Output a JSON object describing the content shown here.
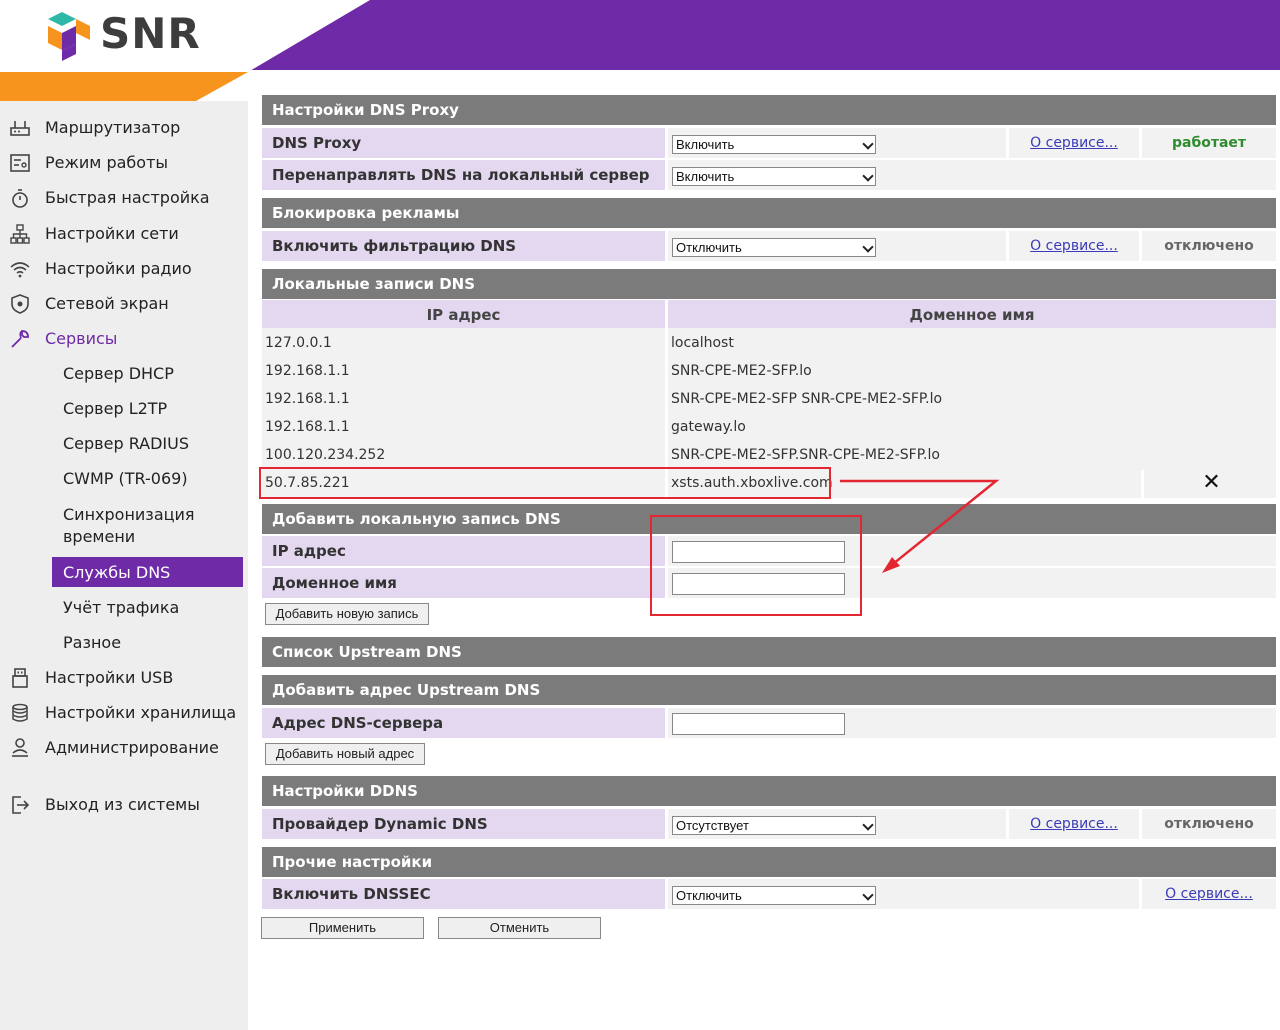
{
  "brand": {
    "name": "SNR",
    "colors": {
      "purple": "#6f2aa8",
      "orange": "#f7941d",
      "dark": "#3d3d3d",
      "highlight": "#e3262f"
    }
  },
  "sidebar": {
    "items": [
      {
        "label": "Маршрутизатор",
        "icon": "router-icon"
      },
      {
        "label": "Режим работы",
        "icon": "mode-icon"
      },
      {
        "label": "Быстрая настройка",
        "icon": "stopwatch-icon"
      },
      {
        "label": "Настройки сети",
        "icon": "network-icon"
      },
      {
        "label": "Настройки радио",
        "icon": "wifi-icon"
      },
      {
        "label": "Сетевой экран",
        "icon": "shield-icon"
      },
      {
        "label": "Сервисы",
        "icon": "wrench-icon"
      },
      {
        "label": "Сервер DHCP"
      },
      {
        "label": "Сервер L2TP"
      },
      {
        "label": "Сервер RADIUS"
      },
      {
        "label": "CWMP (TR-069)"
      },
      {
        "label": "Синхронизация времени"
      },
      {
        "label": "Службы DNS"
      },
      {
        "label": "Учёт трафика"
      },
      {
        "label": "Разное"
      },
      {
        "label": "Настройки USB",
        "icon": "usb-icon"
      },
      {
        "label": "Настройки хранилища",
        "icon": "storage-icon"
      },
      {
        "label": "Администрирование",
        "icon": "admin-icon"
      },
      {
        "label": "Выход из системы",
        "icon": "logout-icon"
      }
    ]
  },
  "dns_proxy": {
    "title": "Настройки DNS Proxy",
    "proxy_label": "DNS Proxy",
    "proxy_value": "Включить",
    "proxy_link": "О сервисе...",
    "proxy_status": "работает",
    "redirect_label": "Перенаправлять DNS на локальный сервер",
    "redirect_value": "Включить"
  },
  "adblock": {
    "title": "Блокировка рекламы",
    "filter_label": "Включить фильтрацию DNS",
    "filter_value": "Отключить",
    "filter_link": "О сервисе...",
    "filter_status": "отключено"
  },
  "local_dns": {
    "title": "Локальные записи DNS",
    "col_ip": "IP адрес",
    "col_domain": "Доменное имя",
    "rows": [
      {
        "ip": "127.0.0.1",
        "domain": "localhost"
      },
      {
        "ip": "192.168.1.1",
        "domain": "SNR-CPE-ME2-SFP.lo"
      },
      {
        "ip": "192.168.1.1",
        "domain": "SNR-CPE-ME2-SFP SNR-CPE-ME2-SFP.lo"
      },
      {
        "ip": "192.168.1.1",
        "domain": "gateway.lo"
      },
      {
        "ip": "100.120.234.252",
        "domain": "SNR-CPE-ME2-SFP.SNR-CPE-ME2-SFP.lo"
      },
      {
        "ip": "50.7.85.221",
        "domain": "xsts.auth.xboxlive.com",
        "delete": "✕"
      }
    ]
  },
  "add_local": {
    "title": "Добавить локальную запись DNS",
    "ip_label": "IP адрес",
    "ip_value": "",
    "domain_label": "Доменное имя",
    "domain_value": "",
    "button": "Добавить новую запись"
  },
  "upstream": {
    "list_title": "Список Upstream DNS",
    "add_title": "Добавить адрес Upstream DNS",
    "server_label": "Адрес DNS-сервера",
    "server_value": "",
    "button": "Добавить новый адрес"
  },
  "ddns": {
    "title": "Настройки DDNS",
    "provider_label": "Провайдер Dynamic DNS",
    "provider_value": "Отсутствует",
    "provider_link": "О сервисе...",
    "provider_status": "отключено"
  },
  "other": {
    "title": "Прочие настройки",
    "dnssec_label": "Включить DNSSEC",
    "dnssec_value": "Отключить",
    "dnssec_link": "О сервисе..."
  },
  "actions": {
    "apply": "Применить",
    "cancel": "Отменить"
  }
}
